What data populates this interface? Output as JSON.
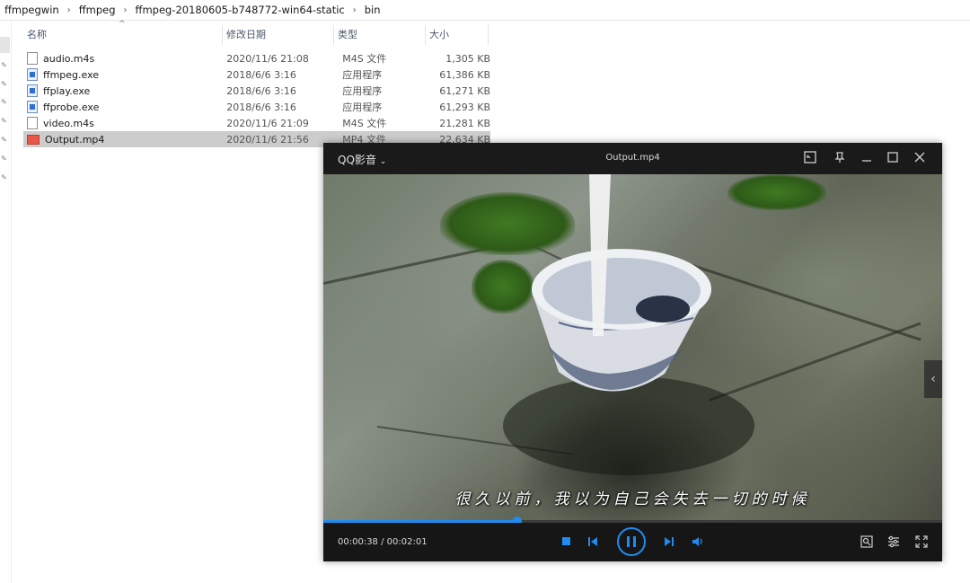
{
  "breadcrumb": [
    "ffmpegwin",
    "ffmpeg",
    "ffmpeg-20180605-b748772-win64-static",
    "bin"
  ],
  "columns": {
    "name": "名称",
    "date": "修改日期",
    "type": "类型",
    "size": "大小"
  },
  "files": [
    {
      "name": "audio.m4s",
      "date": "2020/11/6 21:08",
      "type": "M4S 文件",
      "size": "1,305 KB",
      "icon": "doc-icon"
    },
    {
      "name": "ffmpeg.exe",
      "date": "2018/6/6 3:16",
      "type": "应用程序",
      "size": "61,386 KB",
      "icon": "exe-icon"
    },
    {
      "name": "ffplay.exe",
      "date": "2018/6/6 3:16",
      "type": "应用程序",
      "size": "61,271 KB",
      "icon": "exe-icon"
    },
    {
      "name": "ffprobe.exe",
      "date": "2018/6/6 3:16",
      "type": "应用程序",
      "size": "61,293 KB",
      "icon": "exe-icon"
    },
    {
      "name": "video.m4s",
      "date": "2020/11/6 21:09",
      "type": "M4S 文件",
      "size": "21,281 KB",
      "icon": "doc-icon"
    },
    {
      "name": "Output.mp4",
      "date": "2020/11/6 21:56",
      "type": "MP4 文件",
      "size": "22,634 KB",
      "icon": "mp4-icon",
      "selected": true
    }
  ],
  "player": {
    "app_name": "QQ影音",
    "window_title": "Output.mp4",
    "subtitle": "很久以前，我以为自己会失去一切的时候",
    "time": "00:00:38 / 00:02:01",
    "progress_fraction": 0.314,
    "accent_color": "#1e8cf0"
  }
}
